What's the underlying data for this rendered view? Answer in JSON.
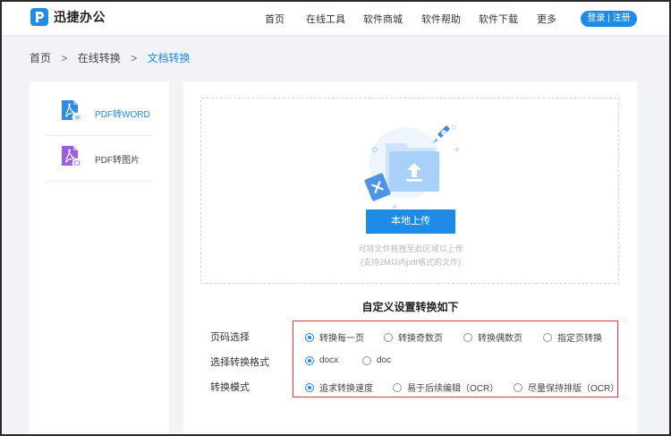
{
  "header": {
    "logo_text": "迅捷办公",
    "nav": [
      "首页",
      "在线工具",
      "软件商城",
      "软件帮助",
      "软件下载",
      "更多"
    ],
    "login_label": "登录 | 注册"
  },
  "breadcrumb": {
    "items": [
      "首页",
      "在线转换",
      "文档转换"
    ],
    "separator": ">"
  },
  "sidebar": {
    "items": [
      {
        "label": "PDF转WORD",
        "icon": "pdf-to-word-icon",
        "active": true
      },
      {
        "label": "PDF转图片",
        "icon": "pdf-to-image-icon",
        "active": false
      }
    ]
  },
  "upload": {
    "button_label": "本地上传",
    "hint_line1": "可将文件拖拽至此区域以上传",
    "hint_line2": "(支持2M以内pdf格式的文件)"
  },
  "settings": {
    "title": "自定义设置转换如下",
    "rows": [
      {
        "label": "页码选择",
        "options": [
          "转换每一页",
          "转换奇数页",
          "转换偶数页",
          "指定页转换"
        ],
        "selected": 0
      },
      {
        "label": "选择转换格式",
        "options": [
          "docx",
          "doc"
        ],
        "selected": 0
      },
      {
        "label": "转换模式",
        "options": [
          "追求转换速度",
          "易于后续编辑（OCR）",
          "尽量保持排版（OCR）"
        ],
        "selected": 0
      }
    ]
  },
  "colors": {
    "accent": "#1e8be6",
    "highlight_border": "#d9363e",
    "background": "#f1f3f7"
  }
}
